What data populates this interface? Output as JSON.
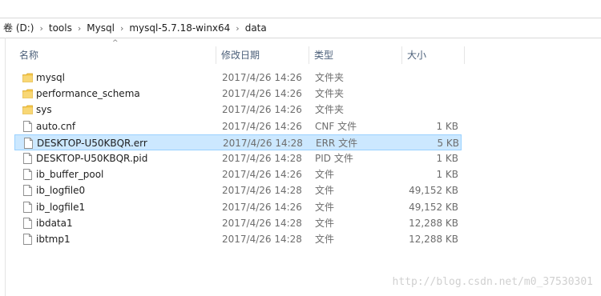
{
  "breadcrumb": [
    "卷 (D:)",
    "tools",
    "Mysql",
    "mysql-5.7.18-winx64",
    "data"
  ],
  "columns": {
    "name": "名称",
    "date": "修改日期",
    "type": "类型",
    "size": "大小"
  },
  "files": [
    {
      "name": "mysql",
      "date": "2017/4/26 14:26",
      "type": "文件夹",
      "size": "",
      "icon": "folder-icon",
      "selected": false
    },
    {
      "name": "performance_schema",
      "date": "2017/4/26 14:26",
      "type": "文件夹",
      "size": "",
      "icon": "folder-icon",
      "selected": false
    },
    {
      "name": "sys",
      "date": "2017/4/26 14:26",
      "type": "文件夹",
      "size": "",
      "icon": "folder-icon",
      "selected": false
    },
    {
      "name": "auto.cnf",
      "date": "2017/4/26 14:26",
      "type": "CNF 文件",
      "size": "1 KB",
      "icon": "file-icon",
      "selected": false
    },
    {
      "name": "DESKTOP-U50KBQR.err",
      "date": "2017/4/26 14:28",
      "type": "ERR 文件",
      "size": "5 KB",
      "icon": "file-icon",
      "selected": true
    },
    {
      "name": "DESKTOP-U50KBQR.pid",
      "date": "2017/4/26 14:28",
      "type": "PID 文件",
      "size": "1 KB",
      "icon": "file-icon",
      "selected": false
    },
    {
      "name": "ib_buffer_pool",
      "date": "2017/4/26 14:26",
      "type": "文件",
      "size": "1 KB",
      "icon": "file-icon",
      "selected": false
    },
    {
      "name": "ib_logfile0",
      "date": "2017/4/26 14:28",
      "type": "文件",
      "size": "49,152 KB",
      "icon": "file-icon",
      "selected": false
    },
    {
      "name": "ib_logfile1",
      "date": "2017/4/26 14:26",
      "type": "文件",
      "size": "49,152 KB",
      "icon": "file-icon",
      "selected": false
    },
    {
      "name": "ibdata1",
      "date": "2017/4/26 14:28",
      "type": "文件",
      "size": "12,288 KB",
      "icon": "file-icon",
      "selected": false
    },
    {
      "name": "ibtmp1",
      "date": "2017/4/26 14:28",
      "type": "文件",
      "size": "12,288 KB",
      "icon": "file-icon",
      "selected": false
    }
  ],
  "watermark": "http://blog.csdn.net/m0_37530301",
  "colors": {
    "selection_bg": "#cce8ff",
    "selection_border": "#99d1ff",
    "folder": "#f4c648",
    "header_text": "#4c607a"
  }
}
